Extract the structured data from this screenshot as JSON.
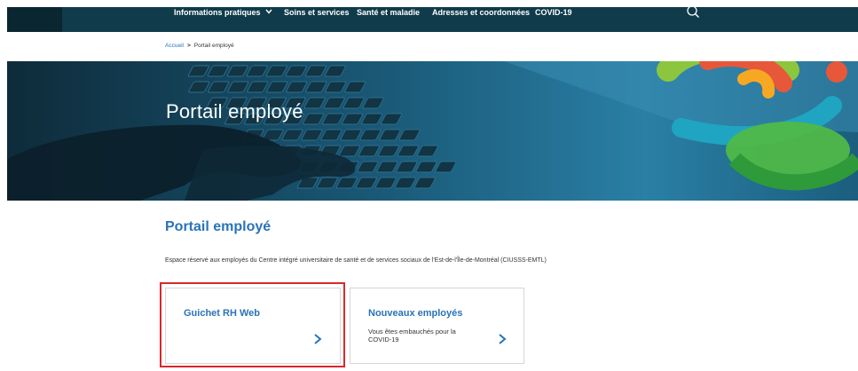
{
  "nav": {
    "items": [
      {
        "label": "Informations pratiques",
        "has_dropdown": true
      },
      {
        "label": "Soins et services"
      },
      {
        "label": "Santé et maladie"
      },
      {
        "label": "Adresses et coordonnées"
      },
      {
        "label": "COVID-19"
      }
    ],
    "search_icon": "search-icon"
  },
  "breadcrumb": {
    "home": "Accueil",
    "separator": ">",
    "current": "Portail employé"
  },
  "hero": {
    "title": "Portail employé"
  },
  "main": {
    "title": "Portail employé",
    "intro": "Espace réservé aux employés du Centre intégré universitaire de santé et de services sociaux de l'Est-de-l'Île-de-Montréal (CIUSSS-EMTL)"
  },
  "cards": [
    {
      "title": "Guichet RH Web",
      "description": "",
      "icon": "chevron-right-icon",
      "highlighted": true
    },
    {
      "title": "Nouveaux employés",
      "description": "Vous êtes embauchés pour la COVID-19",
      "icon": "chevron-right-icon"
    }
  ],
  "colors": {
    "nav_bg": "#0f3b4a",
    "accent_blue": "#2a73b8",
    "highlight_red": "#d9292b"
  }
}
